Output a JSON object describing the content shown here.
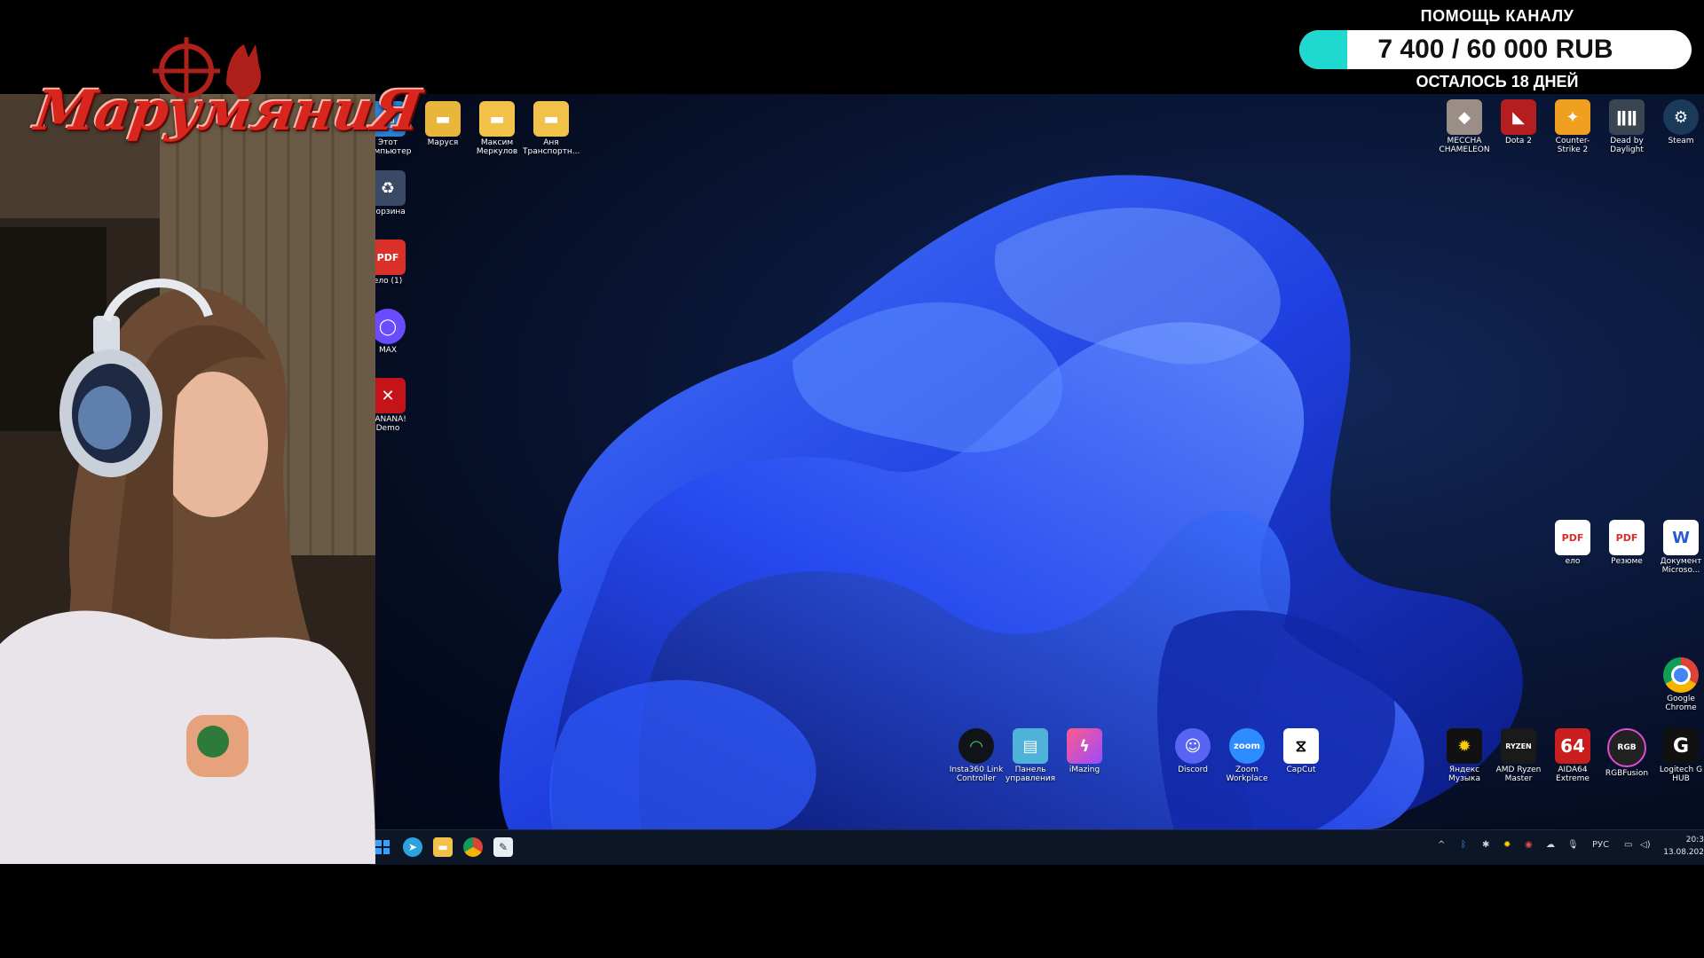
{
  "overlay": {
    "logo_text": "МарумяниЯ",
    "donation": {
      "title": "ПОМОЩЬ КАНАЛУ",
      "amount": "7 400 / 60 000 RUB",
      "progress_fraction": 0.123,
      "remaining": "ОСТАЛОСЬ 18 ДНЕЙ",
      "fill_color": "#1fd9d0"
    }
  },
  "desktop": {
    "left_icons": [
      {
        "label": "Этот компьютер",
        "icon": "monitor-icon"
      },
      {
        "label": "Корзина",
        "icon": "recycle-bin-icon"
      },
      {
        "label": "ело (1)",
        "icon": "pdf-icon"
      },
      {
        "label": "MAX",
        "icon": "max-app-icon"
      },
      {
        "label": "BANANA! Demo",
        "icon": "banana-icon"
      }
    ],
    "top_folders": [
      {
        "label": "Маруся",
        "icon": "folder-icon"
      },
      {
        "label": "Максим Меркулов",
        "icon": "folder-icon"
      },
      {
        "label": "Аня Транспортн...",
        "icon": "folder-icon"
      }
    ],
    "top_right_games": [
      {
        "label": "MECCHA CHAMELEON",
        "icon": "game-icon"
      },
      {
        "label": "Dota 2",
        "icon": "dota-icon"
      },
      {
        "label": "Counter-Strike 2",
        "icon": "cs2-icon"
      },
      {
        "label": "Dead by Daylight",
        "icon": "dbd-icon"
      },
      {
        "label": "Steam",
        "icon": "steam-icon"
      }
    ],
    "right_docs": [
      {
        "label": "ело",
        "icon": "pdf-icon"
      },
      {
        "label": "Резюме",
        "icon": "pdf-icon"
      },
      {
        "label": "Документ Microso...",
        "icon": "word-icon"
      }
    ],
    "chrome": {
      "label": "Google Chrome",
      "icon": "chrome-icon"
    },
    "bottom_icons": [
      {
        "label": "Insta360 Link Controller",
        "icon": "insta360-icon"
      },
      {
        "label": "Панель управления",
        "icon": "control-panel-icon"
      },
      {
        "label": "iMazing",
        "icon": "imazing-icon"
      },
      {
        "label": "Discord",
        "icon": "discord-icon"
      },
      {
        "label": "Zoom Workplace",
        "icon": "zoom-icon",
        "glyph": "zoom"
      },
      {
        "label": "CapCut",
        "icon": "capcut-icon"
      },
      {
        "label": "Яндекс Музыка",
        "icon": "yandex-music-icon"
      },
      {
        "label": "AMD Ryzen Master",
        "icon": "ryzen-icon",
        "glyph": "RYZEN"
      },
      {
        "label": "AIDA64 Extreme",
        "icon": "aida64-icon",
        "glyph": "64"
      },
      {
        "label": "RGBFusion",
        "icon": "rgbfusion-icon",
        "glyph": "RGB"
      },
      {
        "label": "Logitech G HUB",
        "icon": "logitech-icon",
        "glyph": "G"
      }
    ]
  },
  "taskbar": {
    "apps": [
      "windows-start-icon",
      "telegram-icon",
      "explorer-icon",
      "chrome-icon",
      "notepad-icon"
    ],
    "language": "РУС",
    "time": "20:3",
    "date": "13.08.202"
  },
  "colors": {
    "taskbar": "#0d1626",
    "logo_red": "#d8261f"
  }
}
